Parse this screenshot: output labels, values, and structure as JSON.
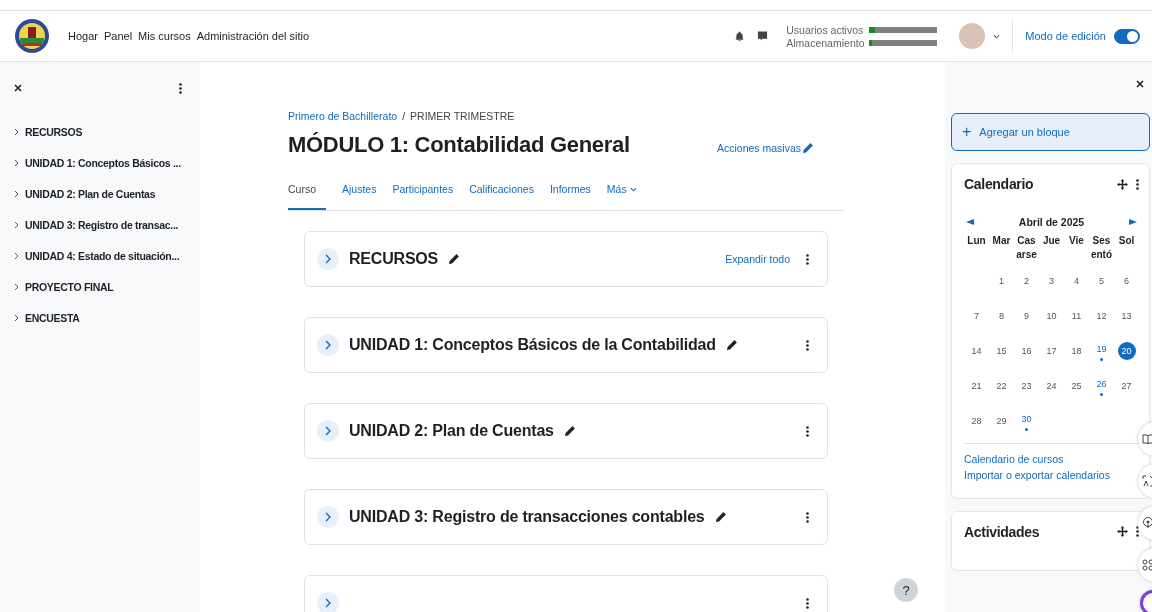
{
  "navbar": {
    "links": [
      "Hogar",
      "Panel",
      "Mis cursos",
      "Administración del sitio"
    ],
    "stats": [
      {
        "label": "Usuarios activos",
        "level": 0.08
      },
      {
        "label": "Almacenamiento",
        "level": 0.04
      }
    ],
    "edit_mode": {
      "label": "Modo de edición",
      "on": true
    }
  },
  "course_index": {
    "items": [
      "RECURSOS",
      "UNIDAD 1: Conceptos Básicos ...",
      "UNIDAD 2: Plan de Cuentas",
      "UNIDAD 3: Registro de transac...",
      "UNIDAD 4: Estado de situación...",
      "PROYECTO FINAL",
      "ENCUESTA"
    ]
  },
  "breadcrumb": {
    "link": "Primero de Bachillerato",
    "separator": "/",
    "current": "PRIMER TRIMESTRE"
  },
  "page_title": "MÓDULO 1: Contabilidad General",
  "bulk_actions": "Acciones masivas",
  "tabs": [
    {
      "label": "Curso",
      "selected": true
    },
    {
      "label": "Ajustes",
      "selected": false
    },
    {
      "label": "Participantes",
      "selected": false
    },
    {
      "label": "Calificaciones",
      "selected": false
    },
    {
      "label": "Informes",
      "selected": false
    },
    {
      "label": "Más",
      "selected": false
    }
  ],
  "sections": [
    {
      "title": "RECURSOS",
      "expand_all": "Expandir todo",
      "expanded": false
    },
    {
      "title": "UNIDAD 1: Conceptos Básicos de la Contabilidad",
      "expanded": false
    },
    {
      "title": "UNIDAD 2: Plan de Cuentas",
      "expanded": false
    },
    {
      "title": "UNIDAD 3: Registro de transacciones contables",
      "expanded": false
    },
    {
      "expanded": false
    }
  ],
  "help": "?",
  "right_drawer": {
    "add_block_icon": "+",
    "add_block": "Agregar un bloque",
    "calendar": {
      "title": "Calendario",
      "month": "Abril de 2025",
      "weekdays": [
        "Lun",
        "Mar",
        "Casarse",
        "Jue",
        "Vie",
        "Sesentó",
        "Sol"
      ],
      "weeks": [
        [
          {
            "day": "1",
            "today": false,
            "event": false
          },
          {
            "day": "2",
            "today": false,
            "event": false
          },
          {
            "day": "3",
            "today": false,
            "event": false
          },
          {
            "day": "4",
            "today": false,
            "event": false
          },
          {
            "day": "5",
            "today": false,
            "event": false
          },
          {
            "day": "6",
            "today": false,
            "event": false
          }
        ],
        [
          {
            "day": "7",
            "today": false,
            "event": false
          },
          {
            "day": "8",
            "today": false,
            "event": false
          },
          {
            "day": "9",
            "today": false,
            "event": false
          },
          {
            "day": "10",
            "today": false,
            "event": false
          },
          {
            "day": "11",
            "today": false,
            "event": false
          },
          {
            "day": "12",
            "today": false,
            "event": false
          },
          {
            "day": "13",
            "today": false,
            "event": false
          }
        ],
        [
          {
            "day": "14",
            "today": false,
            "event": false
          },
          {
            "day": "15",
            "today": false,
            "event": false
          },
          {
            "day": "16",
            "today": false,
            "event": false
          },
          {
            "day": "17",
            "today": false,
            "event": false
          },
          {
            "day": "18",
            "today": false,
            "event": false
          },
          {
            "day": "19",
            "today": false,
            "event": true
          },
          {
            "day": "20",
            "today": true,
            "event": false
          }
        ],
        [
          {
            "day": "21",
            "today": false,
            "event": false
          },
          {
            "day": "22",
            "today": false,
            "event": false
          },
          {
            "day": "23",
            "today": false,
            "event": false
          },
          {
            "day": "24",
            "today": false,
            "event": false
          },
          {
            "day": "25",
            "today": false,
            "event": false
          },
          {
            "day": "26",
            "today": false,
            "event": true
          },
          {
            "day": "27",
            "today": false,
            "event": false
          }
        ],
        [
          {
            "day": "28",
            "today": false,
            "event": false
          },
          {
            "day": "29",
            "today": false,
            "event": false
          },
          {
            "day": "30",
            "today": false,
            "event": true
          }
        ]
      ],
      "links": [
        "Calendario de cursos",
        "Importar o exportar calendarios"
      ]
    },
    "activities": {
      "title": "Actividades"
    }
  }
}
